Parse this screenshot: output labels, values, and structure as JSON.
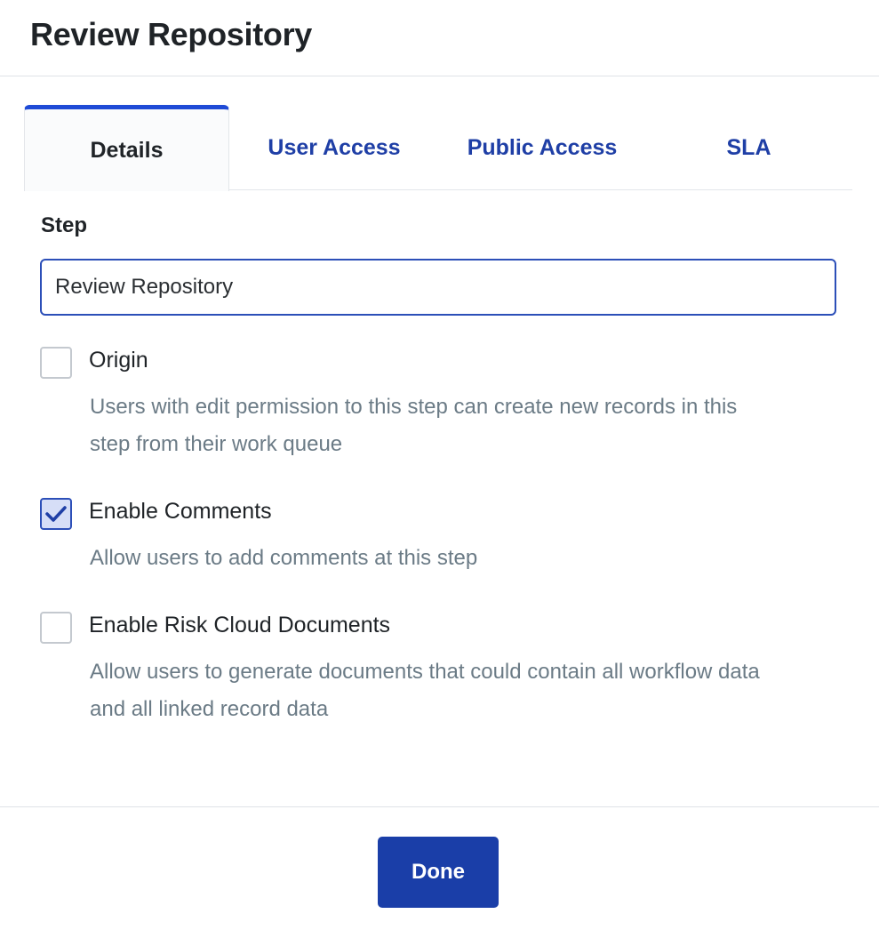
{
  "dialog": {
    "title": "Review Repository"
  },
  "tabs": [
    {
      "label": "Details",
      "active": true
    },
    {
      "label": "User Access",
      "active": false
    },
    {
      "label": "Public Access",
      "active": false
    },
    {
      "label": "SLA",
      "active": false
    }
  ],
  "step": {
    "label": "Step",
    "value": "Review Repository"
  },
  "options": {
    "origin": {
      "label": "Origin",
      "checked": false,
      "description_line1": "Users with edit permission to this step can create new records in this",
      "description_line2": "step from their work queue"
    },
    "comments": {
      "label": "Enable Comments",
      "checked": true,
      "description_line1": "Allow users to add comments at this step"
    },
    "documents": {
      "label": "Enable Risk Cloud Documents",
      "checked": false,
      "description_line1": "Allow users to generate documents that could contain all workflow data",
      "description_line2": "and all linked record data"
    }
  },
  "footer": {
    "done_label": "Done"
  },
  "colors": {
    "accent": "#1f4bd6",
    "primary_button": "#1a3ea8",
    "tab_link": "#1f3fa6",
    "description_text": "#6b7b86"
  }
}
